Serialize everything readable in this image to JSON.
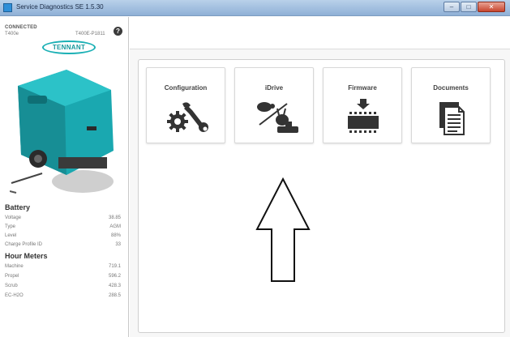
{
  "window": {
    "title": "Service Diagnostics SE 1.5.30",
    "minimize": "–",
    "maximize": "□",
    "close": "✕"
  },
  "sidebar": {
    "connection_status": "CONNECTED",
    "model": "T400e",
    "serial": "T400E-P1811",
    "help": "?",
    "brand": "TENNANT",
    "battery": {
      "title": "Battery",
      "rows": [
        {
          "label": "Voltage",
          "value": "38.85"
        },
        {
          "label": "Type",
          "value": "AGM"
        },
        {
          "label": "Level",
          "value": "88%"
        },
        {
          "label": "Charge Profile ID",
          "value": "33"
        }
      ]
    },
    "hour_meters": {
      "title": "Hour Meters",
      "rows": [
        {
          "label": "Machine",
          "value": "719.1"
        },
        {
          "label": "Propel",
          "value": "596.2"
        },
        {
          "label": "Scrub",
          "value": "428.3"
        },
        {
          "label": "EC-H2O",
          "value": "288.5"
        }
      ]
    }
  },
  "main": {
    "tiles": [
      {
        "label": "Configuration",
        "icon": "tools-gear-wrench-icon"
      },
      {
        "label": "iDrive",
        "icon": "idrive-turtle-rabbit-icon"
      },
      {
        "label": "Firmware",
        "icon": "firmware-chip-download-icon"
      },
      {
        "label": "Documents",
        "icon": "documents-icon"
      }
    ]
  },
  "colors": {
    "titlebar": "#8fb0d6",
    "brand_teal": "#1bb0b5",
    "tile_border": "#d8d8d8"
  }
}
